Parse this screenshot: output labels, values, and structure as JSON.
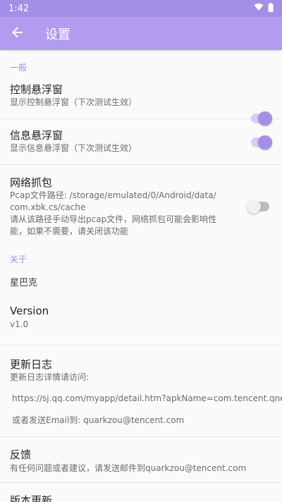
{
  "status_bar": {
    "time": "1:42",
    "icons": [
      "wifi-icon",
      "battery-icon"
    ]
  },
  "toolbar": {
    "back_icon": "arrow-back-icon",
    "title": "设置"
  },
  "colors": {
    "accent": "#a48fe6",
    "toolbar": "#b19cf0",
    "status_bar": "#a48fe6"
  },
  "general": {
    "header": "一般",
    "floating_control": {
      "title": "控制悬浮窗",
      "summary": "显示控制悬浮窗（下次测试生效）",
      "checked": true
    },
    "floating_info": {
      "title": "信息悬浮窗",
      "summary": "显示信息悬浮窗（下次测试生效）",
      "checked": true
    },
    "packet_capture": {
      "title": "网络抓包",
      "summary_line1": "Pcap文件路径: /storage/emulated/0/Android/data/",
      "summary_line2": "com.xbk.cs/cache",
      "summary_line3": "请从该路径手动导出pcap文件，网络抓包可能会影响性",
      "summary_line4": "能，如果不需要，请关闭该功能",
      "checked": false
    }
  },
  "about": {
    "header": "关于",
    "app_name": "星巴克",
    "version": {
      "title": "Version",
      "value": "v1.0"
    },
    "changelog": {
      "title": "更新日志",
      "summary": "更新日志详情请访问:",
      "url": "https://sj.qq.com/myapp/detail.htm?apkName=com.tencent.qnet",
      "email_line": "或者发送Email到: quarkzou@tencent.com"
    },
    "feedback": {
      "title": "反馈",
      "summary": "有任何问题或者建议，请发送邮件到quarkzou@tencent.com"
    },
    "update": {
      "title": "版本更新"
    }
  }
}
